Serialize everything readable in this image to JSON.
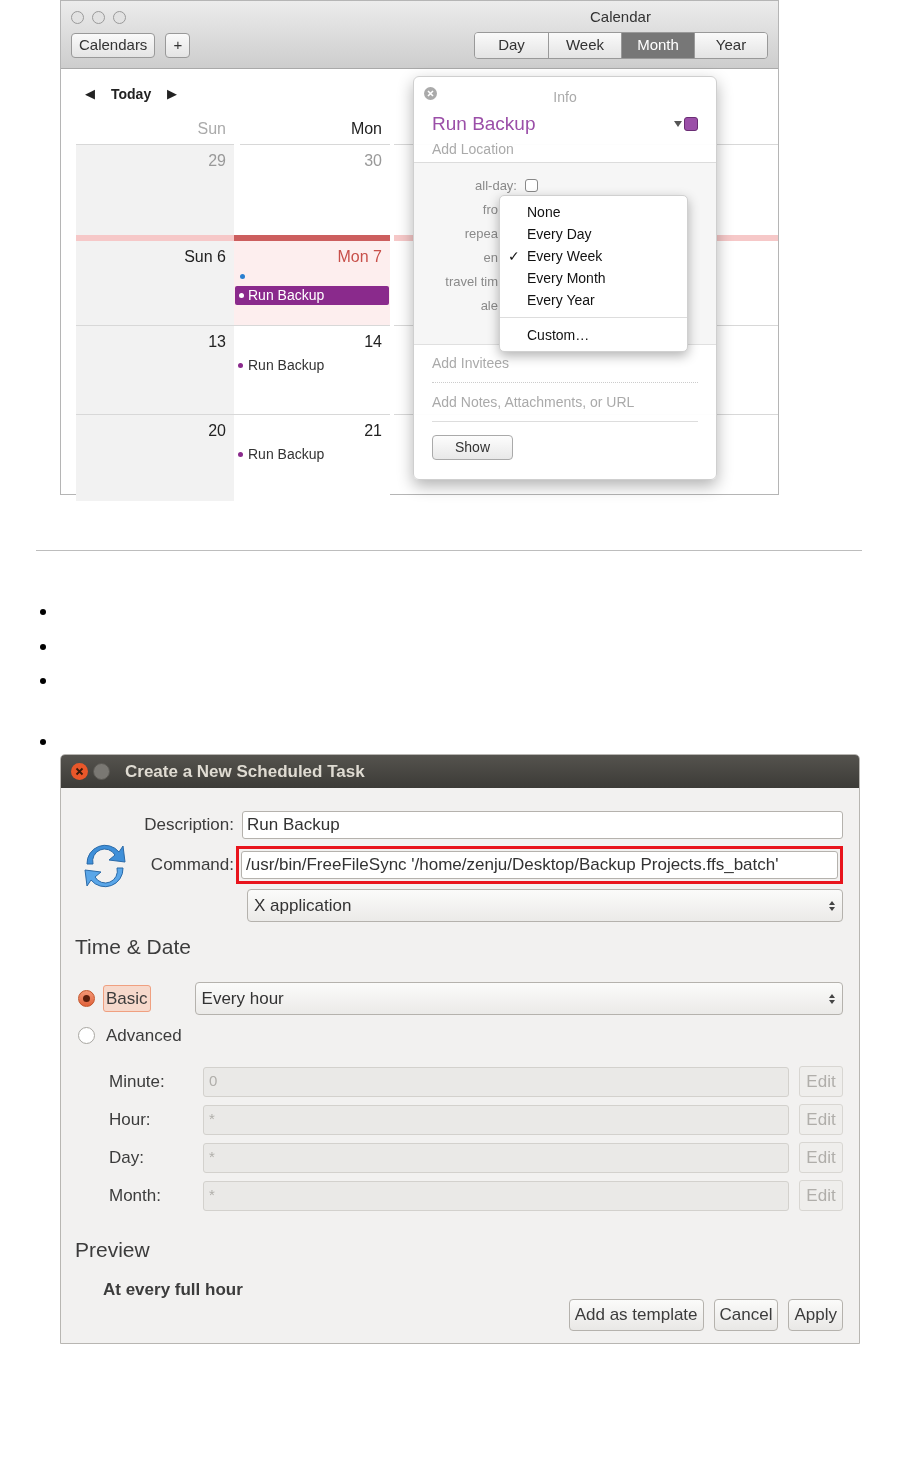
{
  "calendar": {
    "title": "Calendar",
    "toolbar_buttons": [
      "Calendars",
      "+"
    ],
    "views": [
      {
        "label": "Day",
        "selected": false
      },
      {
        "label": "Week",
        "selected": false
      },
      {
        "label": "Month",
        "selected": true
      },
      {
        "label": "Year",
        "selected": false
      }
    ],
    "nav": {
      "prev": "◀",
      "today": "Today",
      "next": "▶"
    },
    "day_headers": [
      {
        "label": "Sun",
        "weekend": true
      },
      {
        "label": "Mon",
        "weekend": false
      }
    ],
    "weeks": [
      {
        "days": [
          {
            "date": "29",
            "other_month": true,
            "today": false
          },
          {
            "date": "30",
            "other_month": true,
            "today": false
          }
        ]
      },
      {
        "days": [
          {
            "date": "Sun 6",
            "other_month": false,
            "today": false
          },
          {
            "date": "Mon 7",
            "other_month": false,
            "today": true,
            "events": [
              {
                "kind": "dot",
                "color": "#2a7fd0"
              },
              {
                "kind": "selected",
                "title": "Run Backup",
                "color": "#8a2a8c"
              }
            ]
          }
        ]
      },
      {
        "days": [
          {
            "date": "13",
            "other_month": false,
            "today": false
          },
          {
            "date": "14",
            "other_month": false,
            "today": false,
            "events": [
              {
                "kind": "plain",
                "title": "Run Backup",
                "color": "#8a2a8c"
              }
            ]
          }
        ]
      },
      {
        "days": [
          {
            "date": "20",
            "other_month": false,
            "today": false
          },
          {
            "date": "21",
            "other_month": false,
            "today": false,
            "events": [
              {
                "kind": "plain",
                "title": "Run Backup",
                "color": "#8a2a8c"
              }
            ]
          }
        ]
      }
    ]
  },
  "info": {
    "title": "Info",
    "event_title": "Run Backup",
    "color": "#9b4fa8",
    "location_placeholder": "Add Location",
    "fields": [
      {
        "label": "all-day:",
        "kind": "checkbox",
        "checked": false
      },
      {
        "label": "fro",
        "kind": "cut"
      },
      {
        "label": "repea",
        "kind": "cut"
      },
      {
        "label": "en",
        "kind": "cut"
      },
      {
        "label": "travel tim",
        "kind": "cut"
      },
      {
        "label": "ale",
        "kind": "cut"
      }
    ],
    "repeat_menu": {
      "items": [
        {
          "label": "None",
          "selected": false
        },
        {
          "label": "Every Day",
          "selected": false
        },
        {
          "label": "Every Week",
          "selected": true
        },
        {
          "label": "Every Month",
          "selected": false
        },
        {
          "label": "Every Year",
          "selected": false
        }
      ],
      "check": "✓",
      "custom": "Custom…"
    },
    "invitees_placeholder": "Add Invitees",
    "notes_placeholder": "Add Notes, Attachments, or URL",
    "button": "Show"
  },
  "dialog": {
    "title": "Create a New Scheduled Task",
    "description": {
      "label": "Description:",
      "value": "Run Backup"
    },
    "command": {
      "label": "Command:",
      "value": "/usr/bin/FreeFileSync '/home/zenju/Desktop/Backup Projects.ffs_batch'",
      "highlighted": true
    },
    "type_select": "X application",
    "time_heading": "Time & Date",
    "modes": [
      {
        "label": "Basic",
        "selected": true
      },
      {
        "label": "Advanced",
        "selected": false
      }
    ],
    "basic_select": "Every hour",
    "fields": [
      {
        "label": "Minute:",
        "value": "0",
        "button": "Edit",
        "disabled": true
      },
      {
        "label": "Hour:",
        "value": "*",
        "button": "Edit",
        "disabled": true
      },
      {
        "label": "Day:",
        "value": "*",
        "button": "Edit",
        "disabled": true
      },
      {
        "label": "Month:",
        "value": "*",
        "button": "Edit",
        "disabled": true
      }
    ],
    "preview_heading": "Preview",
    "preview": "At every full hour",
    "buttons": [
      "Add as template",
      "Cancel",
      "Apply"
    ]
  }
}
